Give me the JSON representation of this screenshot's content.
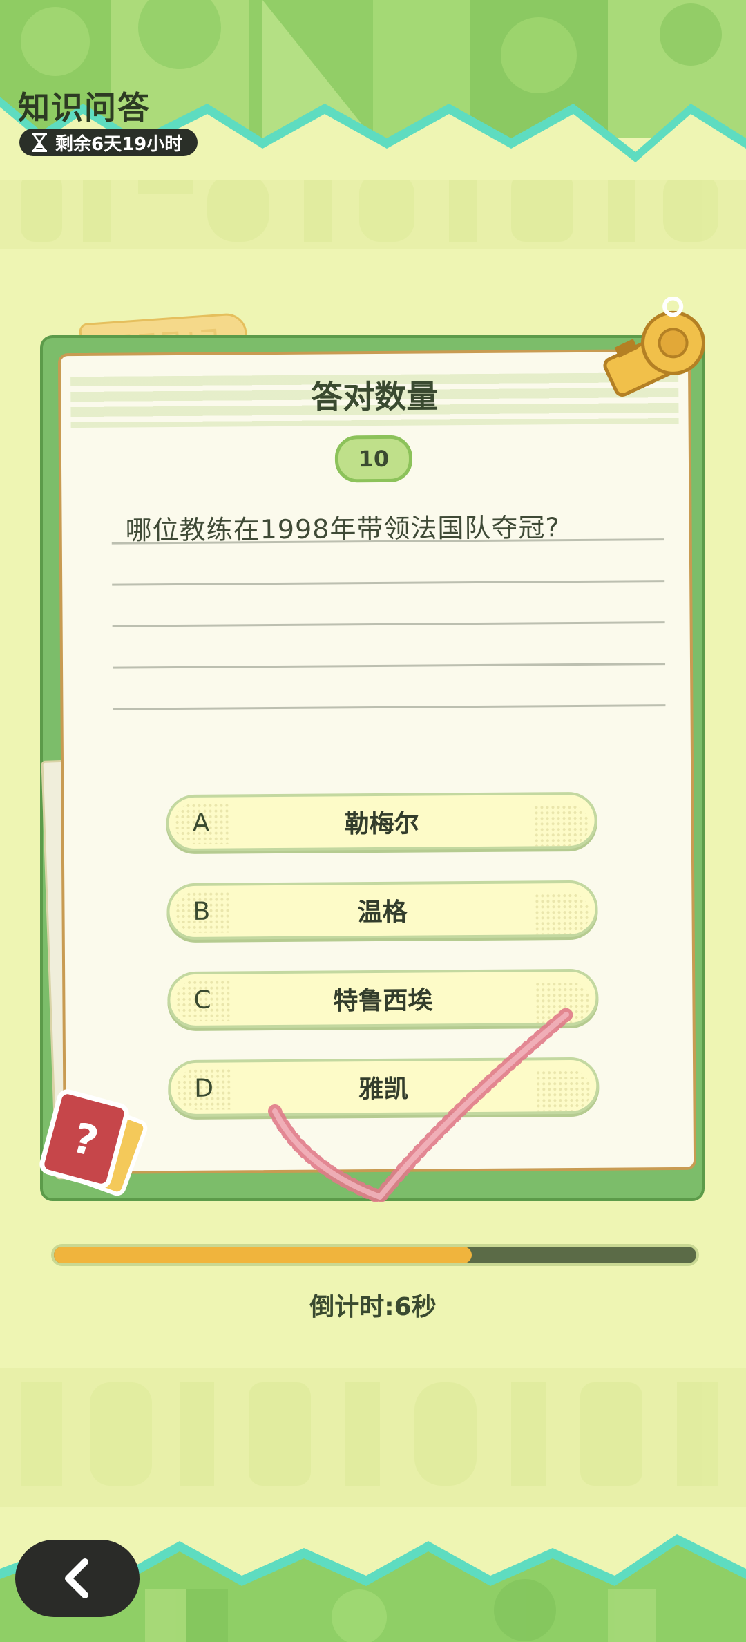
{
  "header": {
    "title": "知识问答",
    "time_remaining": "剩余6天19小时"
  },
  "card": {
    "score_label": "答对数量",
    "score_value": "10",
    "question": "哪位教练在1998年带领法国队夺冠?",
    "options": [
      {
        "letter": "A",
        "text": "勒梅尔"
      },
      {
        "letter": "B",
        "text": "温格"
      },
      {
        "letter": "C",
        "text": "特鲁西埃"
      },
      {
        "letter": "D",
        "text": "雅凯"
      }
    ],
    "correct_option": "D"
  },
  "progress": {
    "fraction": 0.65,
    "countdown_text": "倒计时:6秒"
  },
  "colors": {
    "background": "#eef5b3",
    "card_border": "#c89b52",
    "progress_fill": "#f0b43d",
    "check_mark": "#e07a8a"
  },
  "icons": [
    "hourglass-icon",
    "whistle-icon",
    "question-card-icon",
    "back-arrow-icon",
    "check-mark-icon"
  ]
}
